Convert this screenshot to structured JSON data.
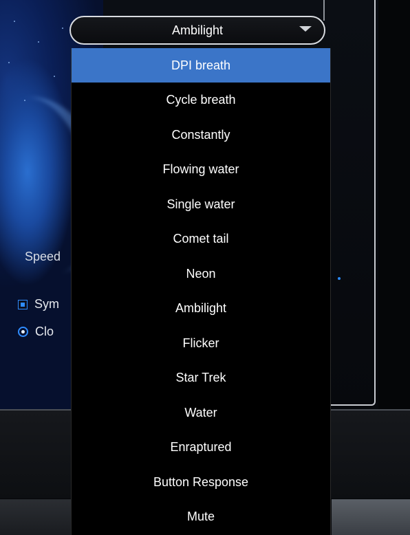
{
  "mode_select": {
    "value": "Ambilight",
    "options": [
      "DPI breath",
      "Cycle breath",
      "Constantly",
      "Flowing water",
      "Single water",
      "Comet tail",
      "Neon",
      "Ambilight",
      "Flicker",
      "Star Trek",
      "Water",
      "Enraptured",
      "Button Response",
      "Mute"
    ],
    "highlighted_index": 0
  },
  "background": {
    "speed_label": "Speed",
    "sync_label": "Sym",
    "clock_label": "Clo"
  },
  "colors": {
    "highlight": "#3b75c8",
    "accent": "#2f8cff",
    "dropdown_bg": "#000000"
  }
}
